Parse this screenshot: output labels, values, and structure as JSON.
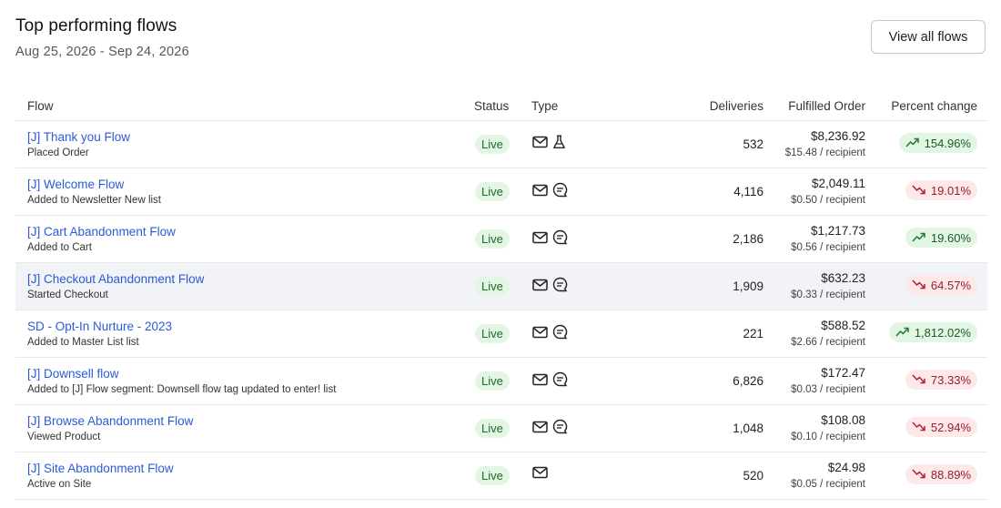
{
  "header": {
    "title": "Top performing flows",
    "date_range": "Aug 25, 2026 - Sep 24, 2026",
    "view_all_label": "View all flows"
  },
  "columns": {
    "flow": "Flow",
    "status": "Status",
    "type": "Type",
    "deliveries": "Deliveries",
    "fulfilled": "Fulfilled Order",
    "change": "Percent change"
  },
  "colors": {
    "link": "#2a5bd7",
    "live_bg": "#e3f6e3",
    "up_bg": "#e3f6e3",
    "down_bg": "#fde8ea"
  },
  "rows": [
    {
      "name": "[J] Thank you Flow",
      "trigger": "Placed Order",
      "status": "Live",
      "icons": [
        "email-icon",
        "ab-test-flask-icon"
      ],
      "deliveries": "532",
      "amount": "$8,236.92",
      "per_recipient": "$15.48 / recipient",
      "change": "154.96%",
      "direction": "up"
    },
    {
      "name": "[J] Welcome Flow",
      "trigger": "Added to Newsletter New list",
      "status": "Live",
      "icons": [
        "email-icon",
        "sms-icon"
      ],
      "deliveries": "4,116",
      "amount": "$2,049.11",
      "per_recipient": "$0.50 / recipient",
      "change": "19.01%",
      "direction": "down"
    },
    {
      "name": "[J] Cart Abandonment Flow",
      "trigger": "Added to Cart",
      "status": "Live",
      "icons": [
        "email-icon",
        "sms-icon"
      ],
      "deliveries": "2,186",
      "amount": "$1,217.73",
      "per_recipient": "$0.56 / recipient",
      "change": "19.60%",
      "direction": "up"
    },
    {
      "name": "[J] Checkout Abandonment Flow",
      "trigger": "Started Checkout",
      "status": "Live",
      "icons": [
        "email-icon",
        "sms-icon"
      ],
      "deliveries": "1,909",
      "amount": "$632.23",
      "per_recipient": "$0.33 / recipient",
      "change": "64.57%",
      "direction": "down"
    },
    {
      "name": "SD - Opt-In Nurture - 2023",
      "trigger": "Added to Master List list",
      "status": "Live",
      "icons": [
        "email-icon",
        "sms-icon"
      ],
      "deliveries": "221",
      "amount": "$588.52",
      "per_recipient": "$2.66 / recipient",
      "change": "1,812.02%",
      "direction": "up"
    },
    {
      "name": "[J] Downsell flow",
      "trigger": "Added to [J] Flow segment: Downsell flow tag updated to enter! list",
      "status": "Live",
      "icons": [
        "email-icon",
        "sms-icon"
      ],
      "deliveries": "6,826",
      "amount": "$172.47",
      "per_recipient": "$0.03 / recipient",
      "change": "73.33%",
      "direction": "down"
    },
    {
      "name": "[J] Browse Abandonment Flow",
      "trigger": "Viewed Product",
      "status": "Live",
      "icons": [
        "email-icon",
        "sms-icon"
      ],
      "deliveries": "1,048",
      "amount": "$108.08",
      "per_recipient": "$0.10 / recipient",
      "change": "52.94%",
      "direction": "down"
    },
    {
      "name": "[J] Site Abandonment Flow",
      "trigger": "Active on Site",
      "status": "Live",
      "icons": [
        "email-icon"
      ],
      "deliveries": "520",
      "amount": "$24.98",
      "per_recipient": "$0.05 / recipient",
      "change": "88.89%",
      "direction": "down"
    }
  ]
}
